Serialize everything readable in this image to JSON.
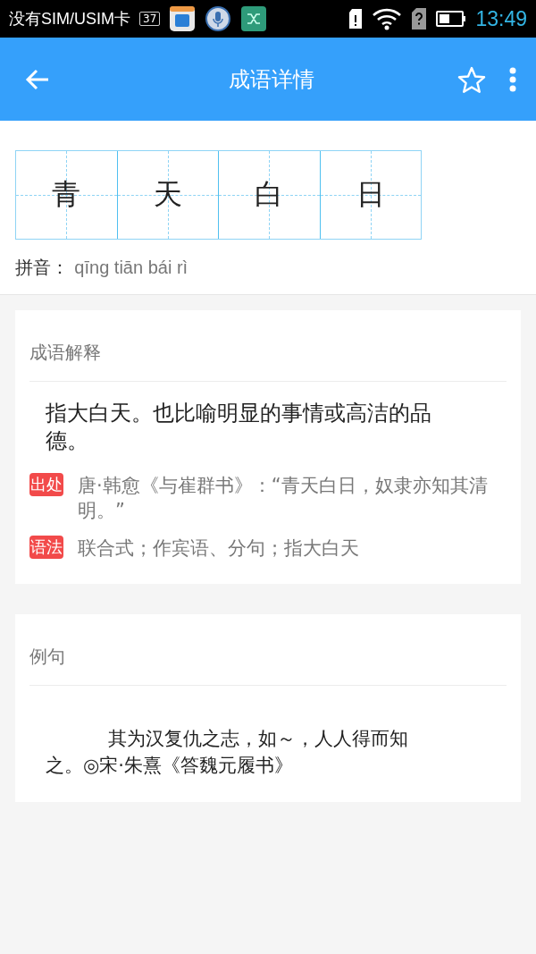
{
  "status_bar": {
    "carrier": "没有SIM/USIM卡",
    "badge": "37",
    "time": "13:49"
  },
  "app_bar": {
    "title": "成语详情",
    "favorite": false
  },
  "characters": [
    "青",
    "天",
    "白",
    "日"
  ],
  "pinyin": {
    "label": "拼音：",
    "value": "qīng tiān bái rì"
  },
  "explanation": {
    "heading": "成语解释",
    "definition": "指大白天。也比喻明显的事情或高洁的品德。",
    "notes": [
      {
        "tag": "出处",
        "text": "唐·韩愈《与崔群书》：“青天白日，奴隶亦知其清明。”"
      },
      {
        "tag": "语法",
        "text": "联合式；作宾语、分句；指大白天"
      }
    ]
  },
  "example": {
    "heading": "例句",
    "text": "其为汉复仇之志，如～，人人得而知之。◎宋·朱熹《答魏元履书》"
  }
}
